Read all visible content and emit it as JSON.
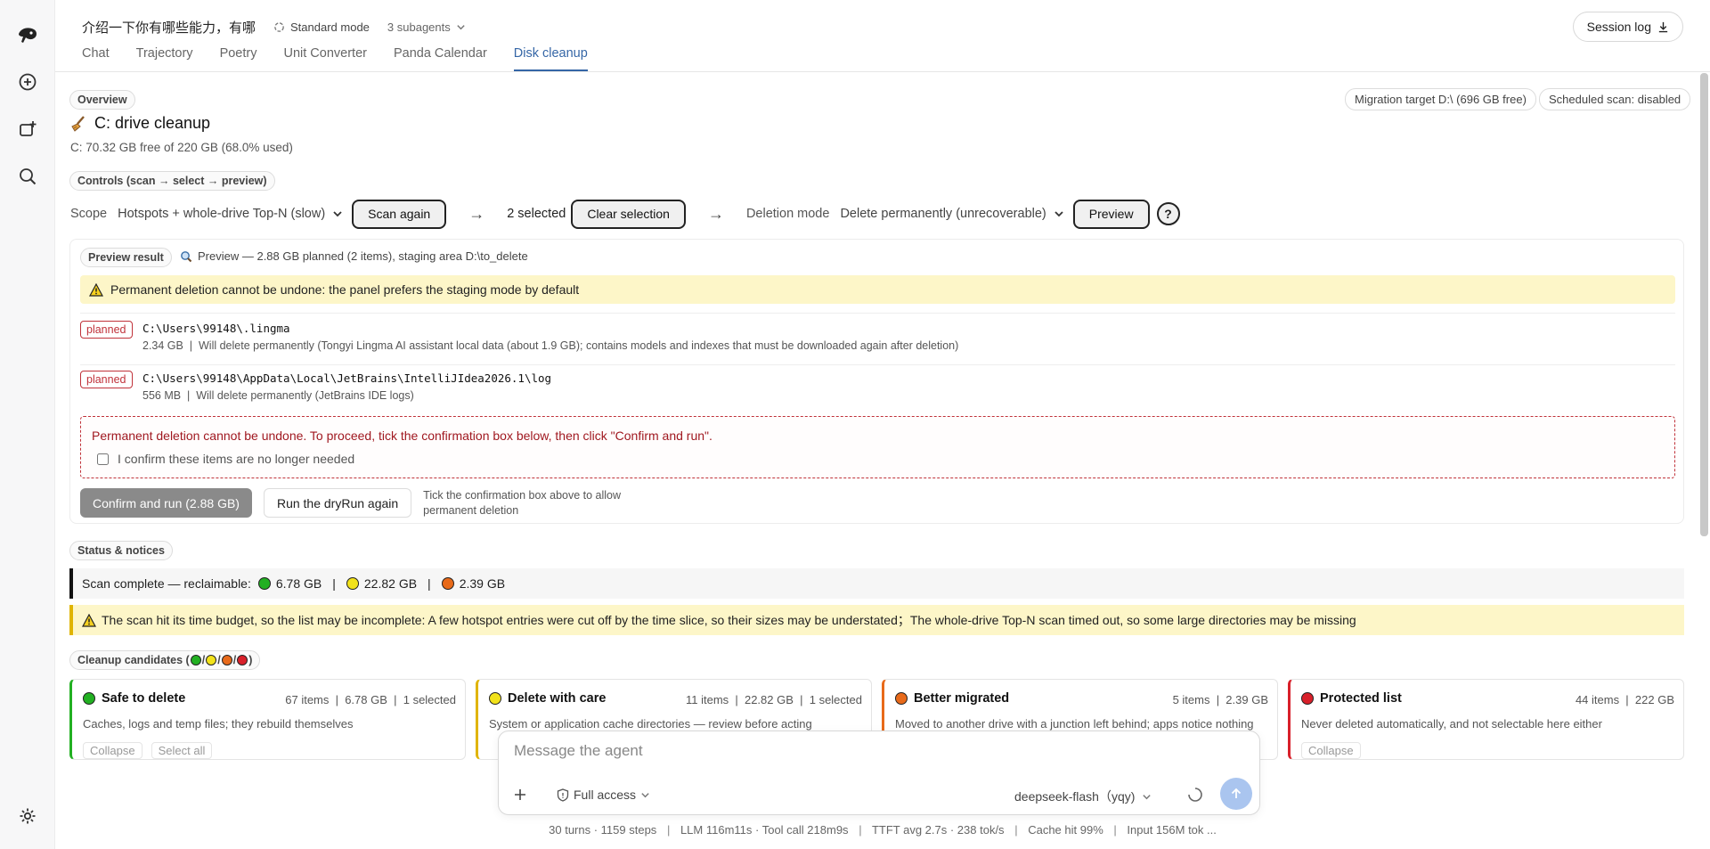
{
  "header": {
    "conversation_title": "介绍一下你有哪些能力，有哪",
    "mode_label": "Standard mode",
    "subagents_label": "3 subagents",
    "session_log_label": "Session log",
    "tabs": [
      {
        "label": "Chat"
      },
      {
        "label": "Trajectory"
      },
      {
        "label": "Poetry"
      },
      {
        "label": "Unit Converter"
      },
      {
        "label": "Panda Calendar"
      },
      {
        "label": "Disk cleanup"
      }
    ],
    "active_tab": "Disk cleanup"
  },
  "overview": {
    "section_chip": "Overview",
    "title": "C: drive cleanup",
    "subtitle": "C: 70.32 GB free of 220 GB (68.0% used)",
    "migration_target": "Migration target D:\\ (696 GB free)",
    "scheduled_scan": "Scheduled scan: disabled"
  },
  "controls": {
    "section_chip": "Controls (scan → select → preview)",
    "scope_label": "Scope",
    "scope_value": "Hotspots + whole-drive Top-N (slow)",
    "scan_button": "Scan again",
    "arrow": "→",
    "selected_count": "2 selected",
    "clear_button": "Clear selection",
    "deletion_mode_label": "Deletion mode",
    "deletion_mode_value": "Delete permanently (unrecoverable)",
    "preview_button": "Preview",
    "help_label": "?"
  },
  "preview": {
    "section_chip": "Preview result",
    "summary": "Preview — 2.88 GB planned (2 items), staging area D:\\to_delete",
    "warning": "Permanent deletion cannot be undone: the panel prefers the staging mode by default",
    "items": [
      {
        "badge": "planned",
        "path": "C:\\Users\\99148\\.lingma",
        "meta": "2.34 GB  |  Will delete permanently (Tongyi Lingma AI assistant local data (about 1.9 GB); contains models and indexes that must be downloaded again after deletion)"
      },
      {
        "badge": "planned",
        "path": "C:\\Users\\99148\\AppData\\Local\\JetBrains\\IntelliJIdea2026.1\\log",
        "meta": "556 MB  |  Will delete permanently (JetBrains IDE logs)"
      }
    ],
    "confirm_warning": "Permanent deletion cannot be undone. To proceed, tick the confirmation box below, then click \"Confirm and run\".",
    "confirm_checkbox_label": "I confirm these items are no longer needed",
    "confirm_checked": false,
    "confirm_button": "Confirm and run (2.88 GB)",
    "dryrun_button": "Run the dryRun again",
    "hint": "Tick the confirmation box above to allow permanent deletion"
  },
  "status": {
    "section_chip": "Status & notices",
    "scan_prefix": "Scan complete — reclaimable:",
    "reclaim": [
      {
        "color": "#22b022",
        "value": "6.78 GB"
      },
      {
        "color": "#f2e21a",
        "value": "22.82 GB"
      },
      {
        "color": "#e86a1a",
        "value": "2.39 GB"
      }
    ],
    "separator": "|",
    "budget_warning": "The scan hit its time budget, so the list may be incomplete: A few hotspot entries were cut off by the time slice, so their sizes may be understated；The whole-drive Top-N scan timed out, so some large directories may be missing"
  },
  "candidates": {
    "section_chip_prefix": "Cleanup candidates (",
    "section_chip_suffix": ")",
    "chip_dot_colors": [
      "#22b022",
      "#f2e21a",
      "#e86a1a",
      "#d8202a"
    ],
    "chip_slash": "/",
    "cards": [
      {
        "color": "#22b022",
        "title": "Safe to delete",
        "stats": "67 items  |  6.78 GB  |  1 selected",
        "desc": "Caches, logs and temp files; they rebuild themselves",
        "actions": [
          "Collapse",
          "Select all"
        ]
      },
      {
        "color": "#f2e21a",
        "title": "Delete with care",
        "stats": "11 items  |  22.82 GB  |  1 selected",
        "desc": "System or application cache directories — review before acting",
        "actions": []
      },
      {
        "color": "#e86a1a",
        "title": "Better migrated",
        "stats": "5 items  |  2.39 GB",
        "desc": "Moved to another drive with a junction left behind; apps notice nothing",
        "actions": []
      },
      {
        "color": "#d8202a",
        "title": "Protected list",
        "stats": "44 items  |  222 GB",
        "desc": "Never deleted automatically, and not selectable here either",
        "actions": [
          "Collapse"
        ]
      }
    ]
  },
  "composer": {
    "placeholder": "Message the agent",
    "access_label": "Full access",
    "model_label": "deepseek-flash（yqy)"
  },
  "footer": {
    "items": [
      "30 turns · 1159 steps",
      "LLM 116m11s · Tool call 218m9s",
      "TTFT avg 2.7s · 238 tok/s",
      "Cache hit 99%",
      "Input 156M tok ..."
    ],
    "separator": "|"
  }
}
